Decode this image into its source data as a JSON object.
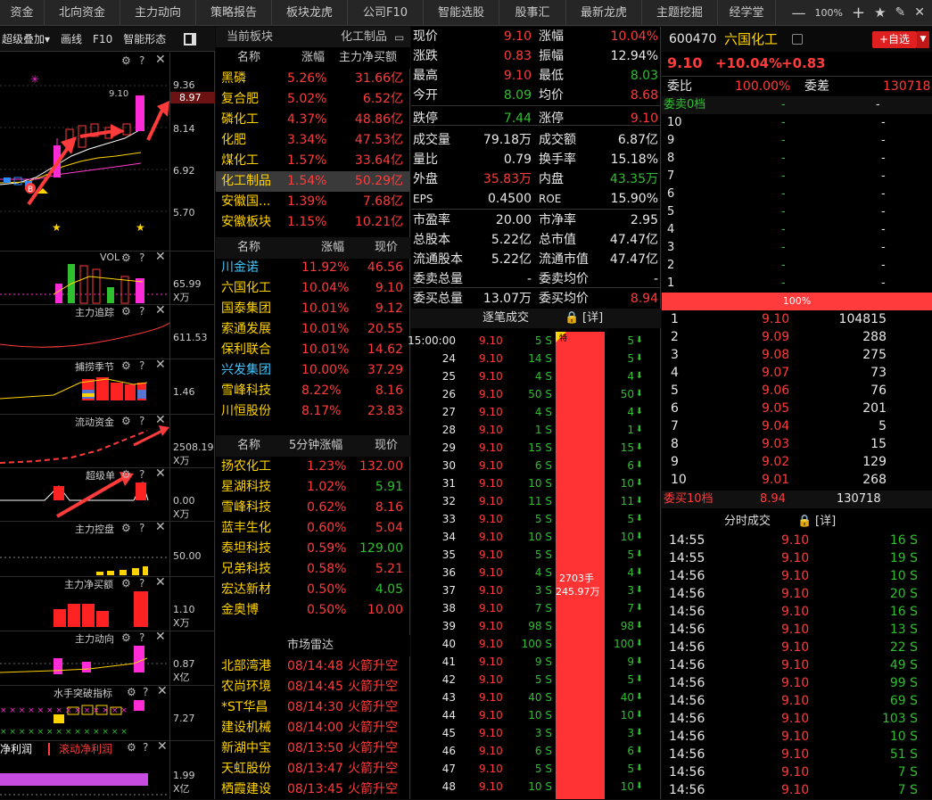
{
  "topnav": {
    "tabs": [
      "资金",
      "北向资金",
      "主力动向",
      "策略报告",
      "板块龙虎",
      "公司F10",
      "智能选股",
      "股事汇",
      "最新龙虎",
      "主题挖掘",
      "经学堂"
    ],
    "zoom": "100%"
  },
  "leftpanel": {
    "toolbar": [
      "超级叠加▾",
      "画线",
      "F10",
      "智能形态"
    ],
    "kline": {
      "axis": [
        "9.36",
        "8.97",
        "8.14",
        "6.92",
        "5.70"
      ],
      "high_label": "9.10",
      "price_tag": "8.97"
    },
    "subs": [
      {
        "title": "VOL",
        "axis": [
          "65.99",
          "X万"
        ]
      },
      {
        "title": "主力追踪",
        "axis": [
          "611.53"
        ]
      },
      {
        "title": "捕捞季节",
        "axis": [
          "1.46"
        ]
      },
      {
        "title": "流动资金",
        "axis": [
          "2508.19",
          "X万"
        ]
      },
      {
        "title": "超级单",
        "axis": [
          "0.00",
          "X万"
        ]
      },
      {
        "title": "主力控盘",
        "axis": [
          "50.00"
        ]
      },
      {
        "title": "主力净买额",
        "axis": [
          "1.10",
          "X万"
        ]
      },
      {
        "title": "主力动向",
        "axis": [
          "0.87",
          "X亿"
        ]
      },
      {
        "title": "水手突破指标",
        "axis": [
          "7.27"
        ]
      },
      {
        "title": "净利润",
        "title2": "滚动净利润",
        "axis": [
          "1.99",
          "X亿"
        ]
      }
    ]
  },
  "sectors": {
    "header": {
      "left": "当前板块",
      "right": "化工制品"
    },
    "cols": [
      "名称",
      "涨幅",
      "主力净买额"
    ],
    "rows": [
      {
        "name": "黑磷",
        "chg": "5.26%",
        "net": "31.66亿"
      },
      {
        "name": "复合肥",
        "chg": "5.02%",
        "net": "6.52亿"
      },
      {
        "name": "磷化工",
        "chg": "4.37%",
        "net": "48.86亿"
      },
      {
        "name": "化肥",
        "chg": "3.34%",
        "net": "47.53亿"
      },
      {
        "name": "煤化工",
        "chg": "1.57%",
        "net": "33.64亿"
      },
      {
        "name": "化工制品",
        "chg": "1.54%",
        "net": "50.29亿"
      },
      {
        "name": "安徽国...",
        "chg": "1.39%",
        "net": "7.68亿"
      },
      {
        "name": "安徽板块",
        "chg": "1.15%",
        "net": "10.21亿"
      }
    ]
  },
  "stocks": {
    "cols": [
      "名称",
      "涨幅",
      "现价"
    ],
    "rows": [
      {
        "name": "川金诺",
        "chg": "11.92%",
        "price": "46.56",
        "cyan": true
      },
      {
        "name": "六国化工",
        "chg": "10.04%",
        "price": "9.10"
      },
      {
        "name": "国泰集团",
        "chg": "10.01%",
        "price": "9.12"
      },
      {
        "name": "索通发展",
        "chg": "10.01%",
        "price": "20.55"
      },
      {
        "name": "保利联合",
        "chg": "10.01%",
        "price": "14.62"
      },
      {
        "name": "兴发集团",
        "chg": "10.00%",
        "price": "37.29",
        "cyan": true
      },
      {
        "name": "雪峰科技",
        "chg": "8.22%",
        "price": "8.16"
      },
      {
        "name": "川恒股份",
        "chg": "8.17%",
        "price": "23.83"
      }
    ]
  },
  "fivemin": {
    "cols": [
      "名称",
      "5分钟涨幅",
      "现价"
    ],
    "rows": [
      {
        "name": "扬农化工",
        "chg": "1.23%",
        "price": "132.00",
        "pc": "r"
      },
      {
        "name": "星湖科技",
        "chg": "1.02%",
        "price": "5.91",
        "pc": "g"
      },
      {
        "name": "雪峰科技",
        "chg": "0.62%",
        "price": "8.16",
        "pc": "r"
      },
      {
        "name": "蓝丰生化",
        "chg": "0.60%",
        "price": "5.04",
        "pc": "r"
      },
      {
        "name": "泰坦科技",
        "chg": "0.59%",
        "price": "129.00",
        "pc": "g"
      },
      {
        "name": "兄弟科技",
        "chg": "0.58%",
        "price": "5.21",
        "pc": "r"
      },
      {
        "name": "宏达新材",
        "chg": "0.50%",
        "price": "4.05",
        "pc": "g"
      },
      {
        "name": "金奥博",
        "chg": "0.50%",
        "price": "10.00",
        "pc": "r"
      }
    ]
  },
  "radar": {
    "title": "市场雷达",
    "rows": [
      {
        "name": "北部湾港",
        "time": "08/14:48",
        "event": "火箭升空"
      },
      {
        "name": "农尚环境",
        "time": "08/14:45",
        "event": "火箭升空"
      },
      {
        "name": "*ST华昌",
        "time": "08/14:30",
        "event": "火箭升空"
      },
      {
        "name": "建设机械",
        "time": "08/14:00",
        "event": "火箭升空"
      },
      {
        "name": "新湖中宝",
        "time": "08/13:50",
        "event": "火箭升空"
      },
      {
        "name": "天虹股份",
        "time": "08/13:47",
        "event": "火箭升空"
      },
      {
        "name": "栖霞建设",
        "time": "08/13:45",
        "event": "火箭升空"
      }
    ]
  },
  "quote": {
    "rows": [
      {
        "l": "现价",
        "lv": "9.10",
        "lc": "r",
        "r": "涨幅",
        "rv": "10.04%",
        "rc": "r"
      },
      {
        "l": "涨跌",
        "lv": "0.83",
        "lc": "r",
        "r": "振幅",
        "rv": "12.94%",
        "rc": "w"
      },
      {
        "l": "最高",
        "lv": "9.10",
        "lc": "r",
        "r": "最低",
        "rv": "8.03",
        "rc": "g"
      },
      {
        "l": "今开",
        "lv": "8.09",
        "lc": "g",
        "r": "均价",
        "rv": "8.68",
        "rc": "r"
      },
      {
        "l": "跌停",
        "lv": "7.44",
        "lc": "g",
        "r": "涨停",
        "rv": "9.10",
        "rc": "r"
      },
      {
        "l": "成交量",
        "lv": "79.18万",
        "lc": "w",
        "r": "成交额",
        "rv": "6.87亿",
        "rc": "w"
      },
      {
        "l": "量比",
        "lv": "0.79",
        "lc": "w",
        "r": "换手率",
        "rv": "15.18%",
        "rc": "w"
      },
      {
        "l": "外盘",
        "lv": "35.83万",
        "lc": "r",
        "r": "内盘",
        "rv": "43.35万",
        "rc": "g"
      },
      {
        "l": "EPS",
        "lv": "0.4500",
        "lc": "w",
        "r": "ROE",
        "rv": "15.90%",
        "rc": "w"
      },
      {
        "l": "市盈率",
        "lv": "20.00",
        "lc": "w",
        "r": "市净率",
        "rv": "2.95",
        "rc": "w"
      },
      {
        "l": "总股本",
        "lv": "5.22亿",
        "lc": "w",
        "r": "总市值",
        "rv": "47.47亿",
        "rc": "w"
      },
      {
        "l": "流通股本",
        "lv": "5.22亿",
        "lc": "w",
        "r": "流通市值",
        "rv": "47.47亿",
        "rc": "w"
      },
      {
        "l": "委卖总量",
        "lv": "-",
        "lc": "w",
        "r": "委卖均价",
        "rv": "-",
        "rc": "w"
      },
      {
        "l": "委买总量",
        "lv": "13.07万",
        "lc": "w",
        "r": "委买均价",
        "rv": "8.94",
        "rc": "r"
      }
    ],
    "ticks_title": "逐笔成交",
    "ticks_detail": "[详]",
    "bar_label1": "2703手",
    "bar_label2": "245.97万",
    "bar_badge": "特",
    "ticks": [
      {
        "t": "15:00:00",
        "p": "9.10",
        "v": "5 S",
        "n": "5"
      },
      {
        "t": "24",
        "p": "9.10",
        "v": "14 S",
        "n": "5"
      },
      {
        "t": "25",
        "p": "9.10",
        "v": "4 S",
        "n": "4"
      },
      {
        "t": "26",
        "p": "9.10",
        "v": "50 S",
        "n": "50"
      },
      {
        "t": "27",
        "p": "9.10",
        "v": "4 S",
        "n": "4"
      },
      {
        "t": "28",
        "p": "9.10",
        "v": "1 S",
        "n": "1"
      },
      {
        "t": "29",
        "p": "9.10",
        "v": "15 S",
        "n": "15"
      },
      {
        "t": "30",
        "p": "9.10",
        "v": "6 S",
        "n": "6"
      },
      {
        "t": "31",
        "p": "9.10",
        "v": "10 S",
        "n": "10"
      },
      {
        "t": "32",
        "p": "9.10",
        "v": "11 S",
        "n": "11"
      },
      {
        "t": "33",
        "p": "9.10",
        "v": "5 S",
        "n": "5"
      },
      {
        "t": "34",
        "p": "9.10",
        "v": "10 S",
        "n": "10"
      },
      {
        "t": "35",
        "p": "9.10",
        "v": "5 S",
        "n": "5"
      },
      {
        "t": "36",
        "p": "9.10",
        "v": "4 S",
        "n": "4"
      },
      {
        "t": "37",
        "p": "9.10",
        "v": "3 S",
        "n": "3"
      },
      {
        "t": "38",
        "p": "9.10",
        "v": "7 S",
        "n": "7"
      },
      {
        "t": "39",
        "p": "9.10",
        "v": "98 S",
        "n": "98"
      },
      {
        "t": "40",
        "p": "9.10",
        "v": "100 S",
        "n": "100"
      },
      {
        "t": "41",
        "p": "9.10",
        "v": "9 S",
        "n": "9"
      },
      {
        "t": "42",
        "p": "9.10",
        "v": "5 S",
        "n": "5"
      },
      {
        "t": "43",
        "p": "9.10",
        "v": "40 S",
        "n": "40"
      },
      {
        "t": "44",
        "p": "9.10",
        "v": "10 S",
        "n": "10"
      },
      {
        "t": "45",
        "p": "9.10",
        "v": "3 S",
        "n": "3"
      },
      {
        "t": "46",
        "p": "9.10",
        "v": "6 S",
        "n": "6"
      },
      {
        "t": "47",
        "p": "9.10",
        "v": "5 S",
        "n": "5"
      },
      {
        "t": "48",
        "p": "9.10",
        "v": "10 S",
        "n": "10"
      }
    ]
  },
  "stock": {
    "code": "600470",
    "name": "六国化工",
    "price": "9.10",
    "pct": "+10.04%",
    "chg": "+0.83",
    "add_button": "+自选"
  },
  "orderbook": {
    "weibi_label": "委比",
    "weibi": "100.00%",
    "weicha_label": "委差",
    "weicha": "130718",
    "sell_label": "委卖0档",
    "sell_rows": [
      "10",
      "9",
      "8",
      "7",
      "6",
      "5",
      "4",
      "3",
      "2",
      "1"
    ],
    "pct_bar": "100%",
    "buy_rows": [
      {
        "n": "1",
        "p": "9.10",
        "v": "104815"
      },
      {
        "n": "2",
        "p": "9.09",
        "v": "288"
      },
      {
        "n": "3",
        "p": "9.08",
        "v": "275"
      },
      {
        "n": "4",
        "p": "9.07",
        "v": "73"
      },
      {
        "n": "5",
        "p": "9.06",
        "v": "76"
      },
      {
        "n": "6",
        "p": "9.05",
        "v": "201"
      },
      {
        "n": "7",
        "p": "9.04",
        "v": "5"
      },
      {
        "n": "8",
        "p": "9.03",
        "v": "15"
      },
      {
        "n": "9",
        "p": "9.02",
        "v": "129"
      },
      {
        "n": "10",
        "p": "9.01",
        "v": "268"
      }
    ],
    "buy_label": "委买10档",
    "buy_avg": "8.94",
    "buy_total": "130718"
  },
  "timetrades": {
    "title": "分时成交",
    "detail": "[详]",
    "rows": [
      {
        "t": "14:55",
        "p": "9.10",
        "v": "16 S"
      },
      {
        "t": "14:55",
        "p": "9.10",
        "v": "19 S"
      },
      {
        "t": "14:56",
        "p": "9.10",
        "v": "10 S"
      },
      {
        "t": "14:56",
        "p": "9.10",
        "v": "20 S"
      },
      {
        "t": "14:56",
        "p": "9.10",
        "v": "16 S"
      },
      {
        "t": "14:56",
        "p": "9.10",
        "v": "13 S"
      },
      {
        "t": "14:56",
        "p": "9.10",
        "v": "22 S"
      },
      {
        "t": "14:56",
        "p": "9.10",
        "v": "49 S"
      },
      {
        "t": "14:56",
        "p": "9.10",
        "v": "99 S"
      },
      {
        "t": "14:56",
        "p": "9.10",
        "v": "69 S"
      },
      {
        "t": "14:56",
        "p": "9.10",
        "v": "103 S"
      },
      {
        "t": "14:56",
        "p": "9.10",
        "v": "10 S"
      },
      {
        "t": "14:56",
        "p": "9.10",
        "v": "51 S"
      },
      {
        "t": "14:56",
        "p": "9.10",
        "v": "7 S"
      },
      {
        "t": "14:56",
        "p": "9.10",
        "v": "7 S"
      }
    ]
  }
}
